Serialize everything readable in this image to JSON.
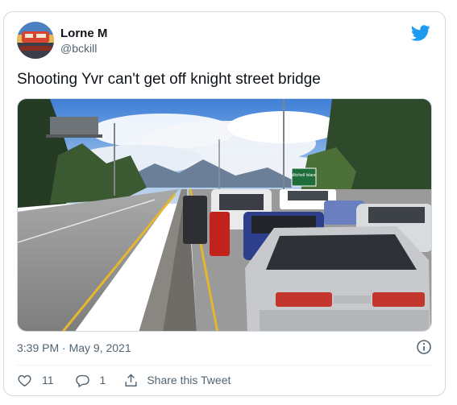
{
  "author": {
    "name": "Lorne M",
    "handle": "@bckill"
  },
  "tweet": {
    "text": "Shooting Yvr can't get off knight street bridge",
    "timestamp": "3:39 PM · May 9, 2021"
  },
  "photo": {
    "sign_text": "Mitchell Island"
  },
  "actions": {
    "likes": "11",
    "replies": "1",
    "share_label": "Share this Tweet"
  },
  "colors": {
    "twitter_blue": "#1d9bf0",
    "secondary_text": "#536471",
    "border": "#cfd9de"
  },
  "icons": [
    "twitter-logo-icon",
    "info-icon",
    "heart-icon",
    "reply-icon",
    "share-icon"
  ]
}
